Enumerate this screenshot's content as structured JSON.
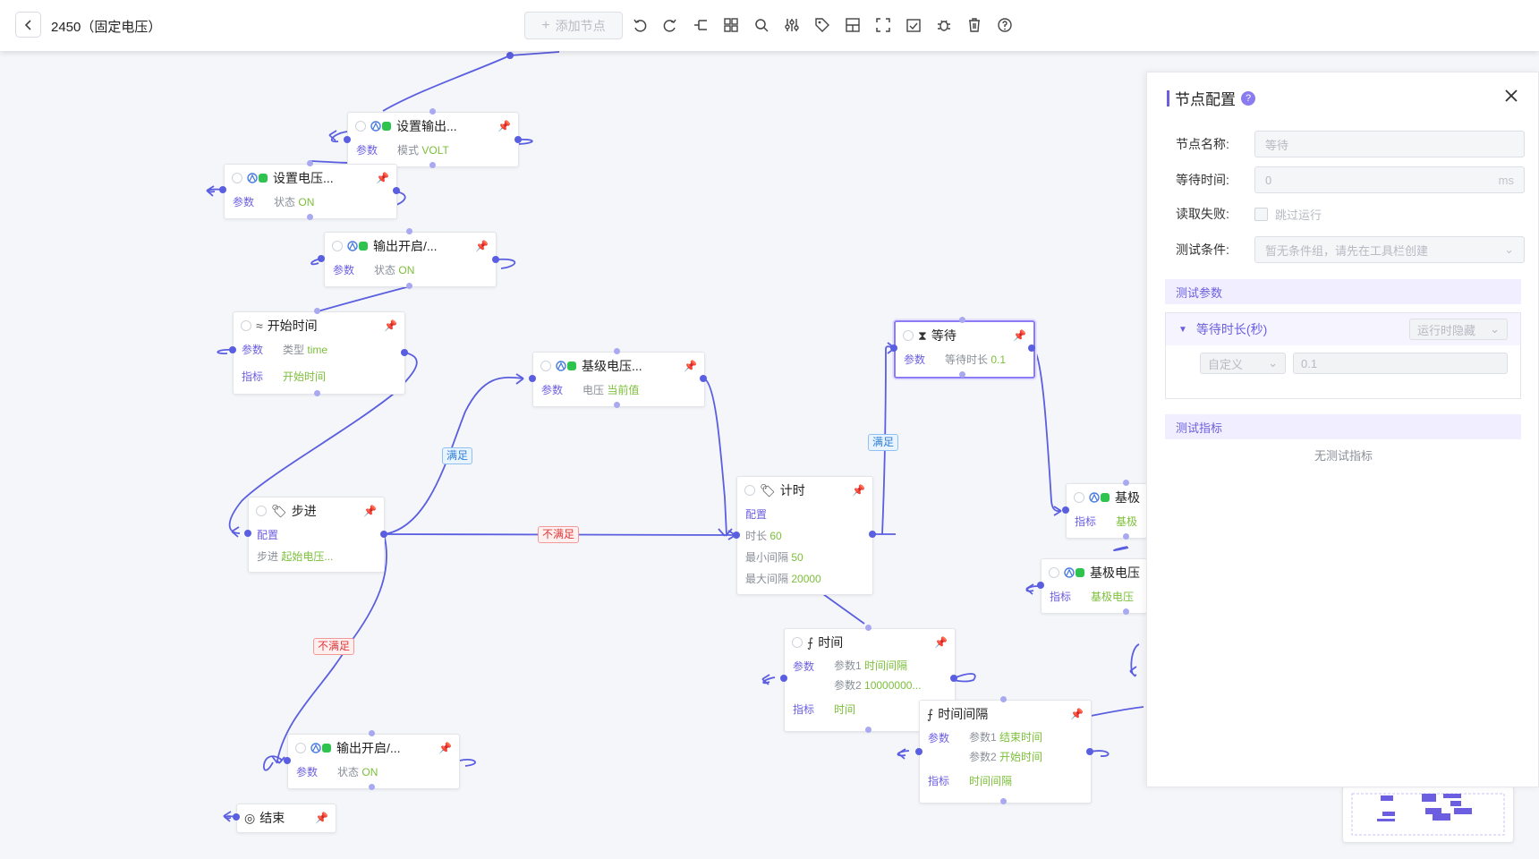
{
  "header": {
    "title": "2450（固定电压）",
    "add_node_label": "添加节点"
  },
  "colors": {
    "accent": "#6b5ee0",
    "edge": "#5a5ee0",
    "ok": "#2d7fd8",
    "fail": "#e0363a",
    "value": "#7cbf3a"
  },
  "toolbar_icons": [
    "undo-icon",
    "redo-icon",
    "branch-icon",
    "grid-layout-icon",
    "search-icon",
    "sliders-icon",
    "tag-icon",
    "layout-icon",
    "fullscreen-icon",
    "calendar-check-icon",
    "bug-icon",
    "trash-icon",
    "help-icon"
  ],
  "nodes": {
    "set_output": {
      "title": "设置输出...",
      "rows": [
        {
          "label": "参数",
          "items": [
            {
              "k": "模式",
              "v": "VOLT"
            }
          ]
        }
      ]
    },
    "set_voltage": {
      "title": "设置电压...",
      "rows": [
        {
          "label": "参数",
          "items": [
            {
              "k": "状态",
              "v": "ON"
            }
          ]
        }
      ]
    },
    "output_on_1": {
      "title": "输出开启/...",
      "rows": [
        {
          "label": "参数",
          "items": [
            {
              "k": "状态",
              "v": "ON"
            }
          ]
        }
      ]
    },
    "start_time": {
      "title": "开始时间",
      "rows": [
        {
          "label": "参数",
          "items": [
            {
              "k": "类型",
              "v": "time"
            }
          ]
        },
        {
          "label": "指标",
          "items": [
            {
              "k": "",
              "v": "开始时间"
            }
          ]
        }
      ]
    },
    "base_voltage_1": {
      "title": "基级电压...",
      "rows": [
        {
          "label": "参数",
          "items": [
            {
              "k": "电压",
              "v": "当前值"
            }
          ]
        }
      ]
    },
    "step": {
      "title": "步进",
      "rows": [
        {
          "label": "配置",
          "items": []
        },
        {
          "label": "",
          "items": [
            {
              "k": "步进",
              "v": "起始电压..."
            }
          ]
        }
      ]
    },
    "timer": {
      "title": "计时",
      "rows": [
        {
          "label": "配置",
          "items": []
        },
        {
          "label": "",
          "items": [
            {
              "k": "时长",
              "v": "60"
            },
            {
              "k": "最小间隔",
              "v": "50"
            },
            {
              "k": "最大间隔",
              "v": "20000"
            }
          ]
        }
      ]
    },
    "wait": {
      "title": "等待",
      "rows": [
        {
          "label": "参数",
          "items": [
            {
              "k": "等待时长",
              "v": "0.1"
            }
          ]
        }
      ]
    },
    "time": {
      "title": "时间",
      "rows": [
        {
          "label": "参数",
          "items": [
            {
              "k": "参数1",
              "v": "时间间隔"
            },
            {
              "k": "参数2",
              "v": "10000000..."
            }
          ]
        },
        {
          "label": "指标",
          "items": [
            {
              "k": "",
              "v": "时间"
            }
          ]
        }
      ]
    },
    "time_interval": {
      "title": "时间间隔",
      "rows": [
        {
          "label": "参数",
          "items": [
            {
              "k": "参数1",
              "v": "结束时间"
            },
            {
              "k": "参数2",
              "v": "开始时间"
            }
          ]
        },
        {
          "label": "指标",
          "items": [
            {
              "k": "",
              "v": "时间间隔"
            }
          ]
        }
      ]
    },
    "base_2": {
      "title": "基极",
      "rows": [
        {
          "label": "指标",
          "items": [
            {
              "k": "",
              "v": "基极"
            }
          ]
        }
      ]
    },
    "base_voltage_3": {
      "title": "基极电压",
      "rows": [
        {
          "label": "指标",
          "items": [
            {
              "k": "",
              "v": "基极电压"
            }
          ]
        }
      ]
    },
    "output_on_2": {
      "title": "输出开启/...",
      "rows": [
        {
          "label": "参数",
          "items": [
            {
              "k": "状态",
              "v": "ON"
            }
          ]
        }
      ]
    },
    "end": {
      "title": "结束",
      "rows": []
    }
  },
  "edge_labels": {
    "ok": "满足",
    "fail": "不满足"
  },
  "panel": {
    "title": "节点配置",
    "name_label": "节点名称:",
    "name_value": "等待",
    "wait_label": "等待时间:",
    "wait_value": "0",
    "wait_unit": "ms",
    "read_fail_label": "读取失败:",
    "skip_label": "跳过运行",
    "cond_label": "测试条件:",
    "cond_placeholder": "暂无条件组，请先在工具栏创建",
    "params_section": "测试参数",
    "param_name": "等待时长(秒)",
    "param_visibility": "运行时隐藏",
    "param_mode": "自定义",
    "param_value": "0.1",
    "metrics_section": "测试指标",
    "no_metrics": "无测试指标"
  }
}
